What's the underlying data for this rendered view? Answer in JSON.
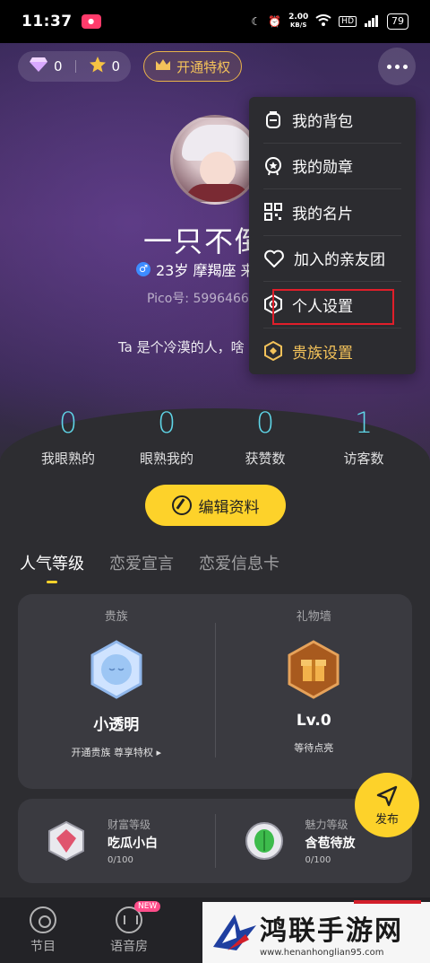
{
  "status_bar": {
    "time": "11:37",
    "net_speed": "2.00",
    "net_unit": "KB/S",
    "battery": "79"
  },
  "wallet": {
    "diamonds": "0",
    "stars": "0"
  },
  "vip_button": "开通特权",
  "profile": {
    "nickname": "一只不倒",
    "age_sign": "23岁 摩羯座 来",
    "pico_id": "Pico号: 5996466",
    "bio": "Ta 是个冷漠的人，啥"
  },
  "stats": [
    {
      "value": "0",
      "label": "我眼熟的"
    },
    {
      "value": "0",
      "label": "眼熟我的"
    },
    {
      "value": "0",
      "label": "获赞数"
    },
    {
      "value": "1",
      "label": "访客数"
    }
  ],
  "edit_button": "编辑资料",
  "tabs": [
    "人气等级",
    "恋爱宣言",
    "恋爱信息卡"
  ],
  "card": {
    "noble": {
      "caption": "贵族",
      "title": "小透明",
      "sub": "开通贵族 尊享特权 ▸"
    },
    "gift": {
      "caption": "礼物墙",
      "title": "Lv.0",
      "sub": "等待点亮"
    }
  },
  "levels": {
    "wealth": {
      "caption": "财富等级",
      "name": "吃瓜小白",
      "progress": "0/100"
    },
    "charm": {
      "caption": "魅力等级",
      "name": "含苞待放",
      "progress": "0/100"
    }
  },
  "publish_button": "发布",
  "bottom_nav": [
    {
      "label": "节目"
    },
    {
      "label": "语音房",
      "badge": "NEW"
    }
  ],
  "menu": [
    {
      "label": "我的背包",
      "icon": "backpack-icon"
    },
    {
      "label": "我的勋章",
      "icon": "medal-icon"
    },
    {
      "label": "我的名片",
      "icon": "qr-card-icon"
    },
    {
      "label": "加入的亲友团",
      "icon": "hearts-icon"
    },
    {
      "label": "个人设置",
      "icon": "settings-hex-icon"
    },
    {
      "label": "贵族设置",
      "icon": "noble-hex-icon"
    }
  ],
  "watermark": {
    "title": "鸿联手游网",
    "url": "www.henanhonglian95.com"
  },
  "colors": {
    "accent_yellow": "#fdd22a",
    "stat_cyan": "#5fd6e8",
    "gold": "#f3c25a",
    "highlight_red": "#e01e2a"
  }
}
